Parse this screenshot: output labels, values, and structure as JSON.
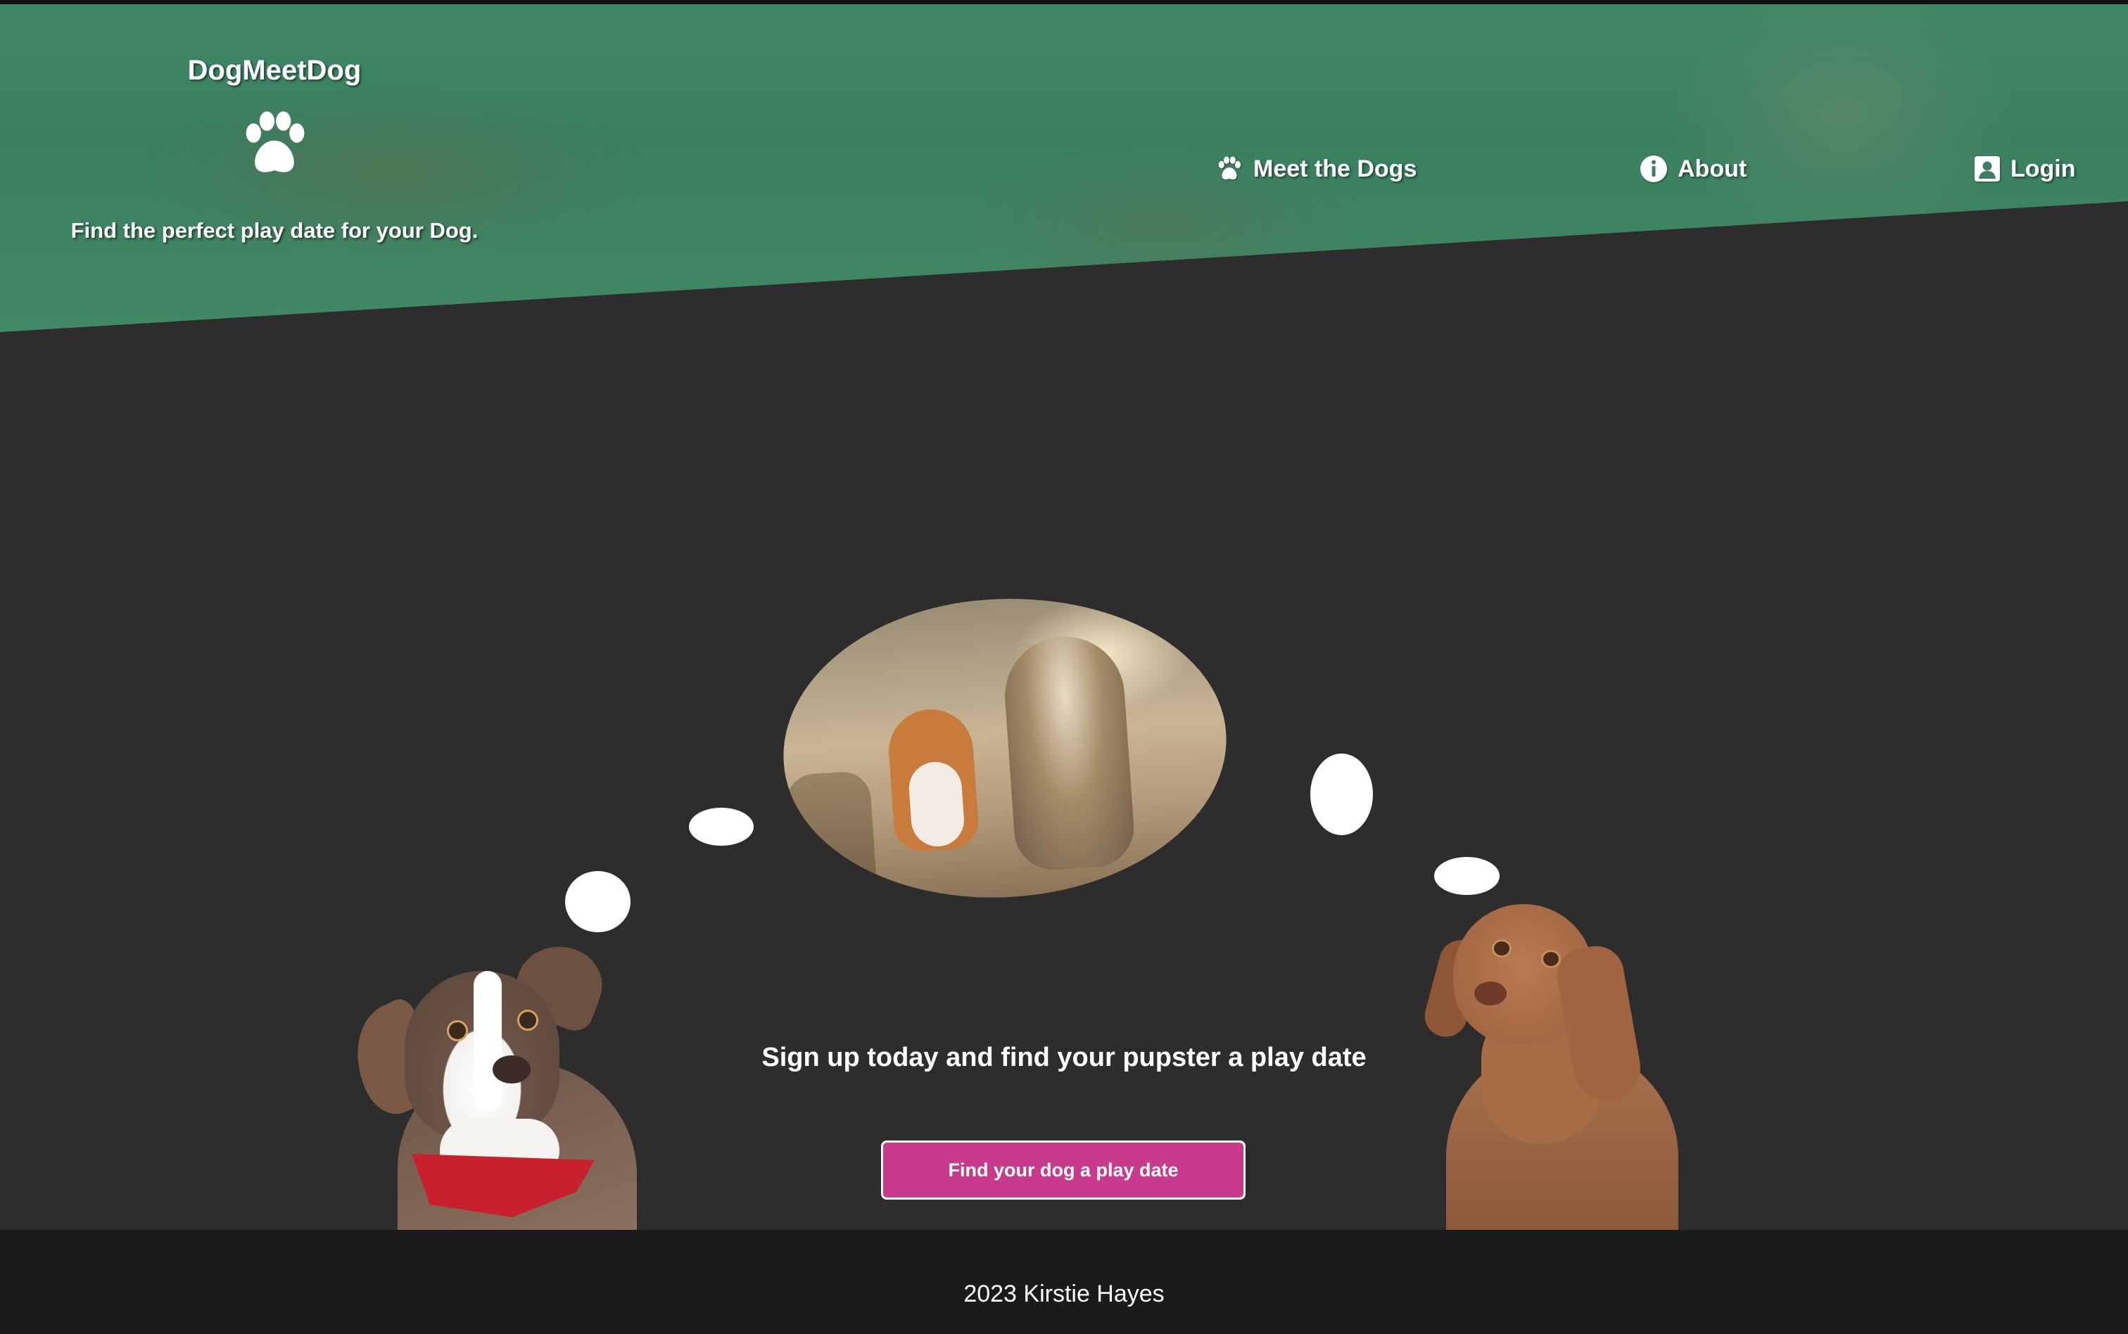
{
  "header": {
    "brand_title": "DogMeetDog",
    "tagline": "Find the perfect play date for your Dog.",
    "logo_icon": "paw-icon",
    "overlay_color": "#3f8a66"
  },
  "nav": {
    "items": [
      {
        "label": "Meet the Dogs",
        "icon": "paw-icon"
      },
      {
        "label": "About",
        "icon": "info-icon"
      },
      {
        "label": "Login",
        "icon": "user-icon"
      }
    ]
  },
  "main": {
    "cta_text": "Sign up today and find your pupster a play date",
    "cta_button": "Find your dog a play date",
    "button_color": "#c73a8c",
    "background_color": "#2d2d2d"
  },
  "footer": {
    "text": "2023 Kirstie Hayes"
  }
}
